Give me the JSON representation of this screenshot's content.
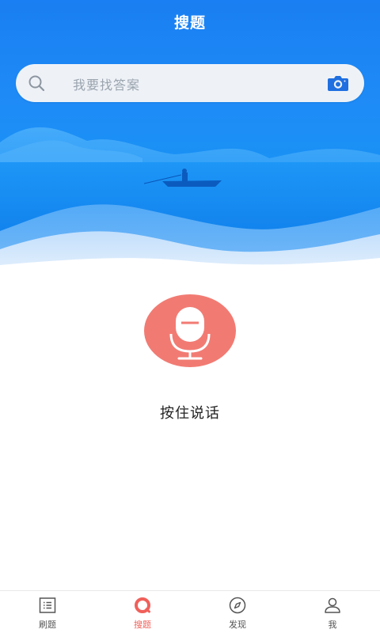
{
  "header": {
    "title": "搜题"
  },
  "search": {
    "placeholder": "我要找答案"
  },
  "voice": {
    "label": "按住说话"
  },
  "tabs": [
    {
      "label": "刷题",
      "icon": "list-icon",
      "active": false
    },
    {
      "label": "搜题",
      "icon": "search-ring-icon",
      "active": true
    },
    {
      "label": "发现",
      "icon": "compass-icon",
      "active": false
    },
    {
      "label": "我",
      "icon": "user-icon",
      "active": false
    }
  ],
  "colors": {
    "primary_blue": "#1a7ff2",
    "mic_red": "#f17b73",
    "active_tab": "#f0605a"
  }
}
